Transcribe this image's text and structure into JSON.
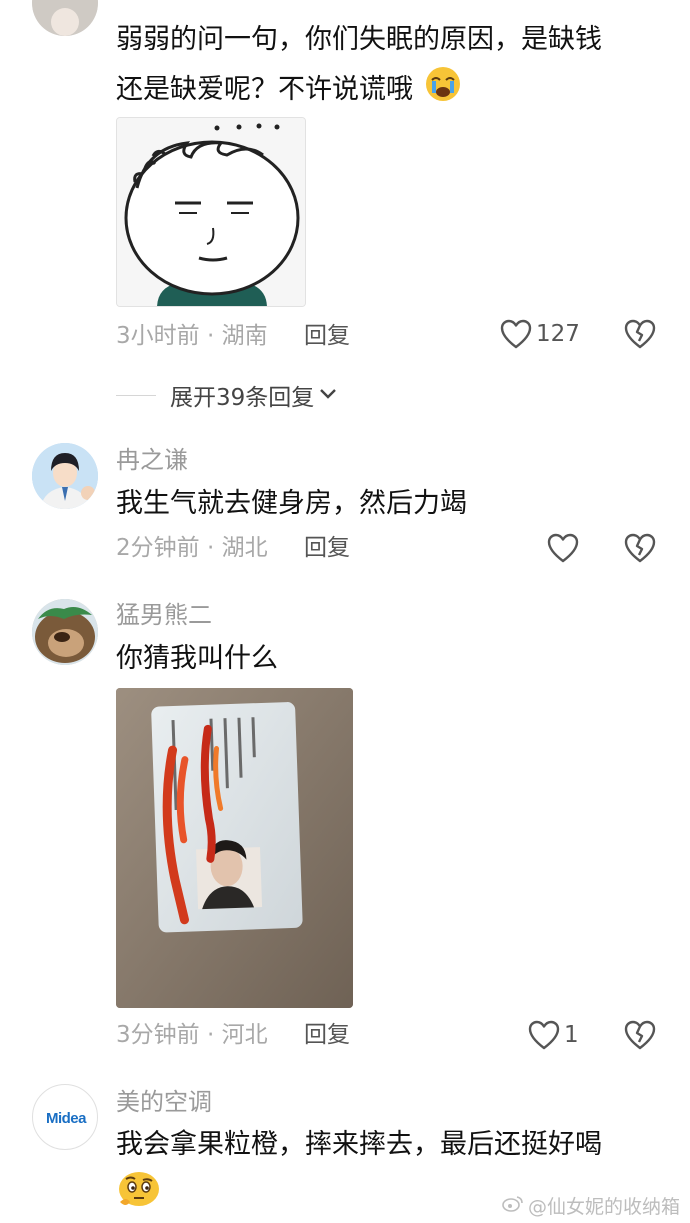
{
  "comments": [
    {
      "username": "",
      "text_lines": [
        "弱弱的问一句，你们失眠的原因，是缺钱",
        "还是缺爱呢？不许说谎哦"
      ],
      "emoji": "crying-face-emoji",
      "image": "meme-face-image",
      "time": "3小时前",
      "location": "湖南",
      "reply_label": "回复",
      "likes": "127",
      "expand_label": "展开39条回复"
    },
    {
      "username": "冉之谦",
      "text_lines": [
        "我生气就去健身房，然后力竭"
      ],
      "time": "2分钟前",
      "location": "湖北",
      "reply_label": "回复",
      "likes": ""
    },
    {
      "username": "猛男熊二",
      "text_lines": [
        "你猜我叫什么"
      ],
      "image": "id-card-photo",
      "time": "3分钟前",
      "location": "河北",
      "reply_label": "回复",
      "likes": "1"
    },
    {
      "username": "美的空调",
      "avatar_brand": "Midea",
      "text_lines": [
        "我会拿果粒橙，摔来摔去，最后还挺好喝"
      ],
      "emoji": "thinking-face-emoji"
    }
  ],
  "separator": " · ",
  "watermark": "@仙女妮的收纳箱",
  "colors": {
    "username": "#9a9a9a",
    "meta": "#a8a8a8",
    "text": "#111111",
    "brand": "#1a6fc4"
  }
}
